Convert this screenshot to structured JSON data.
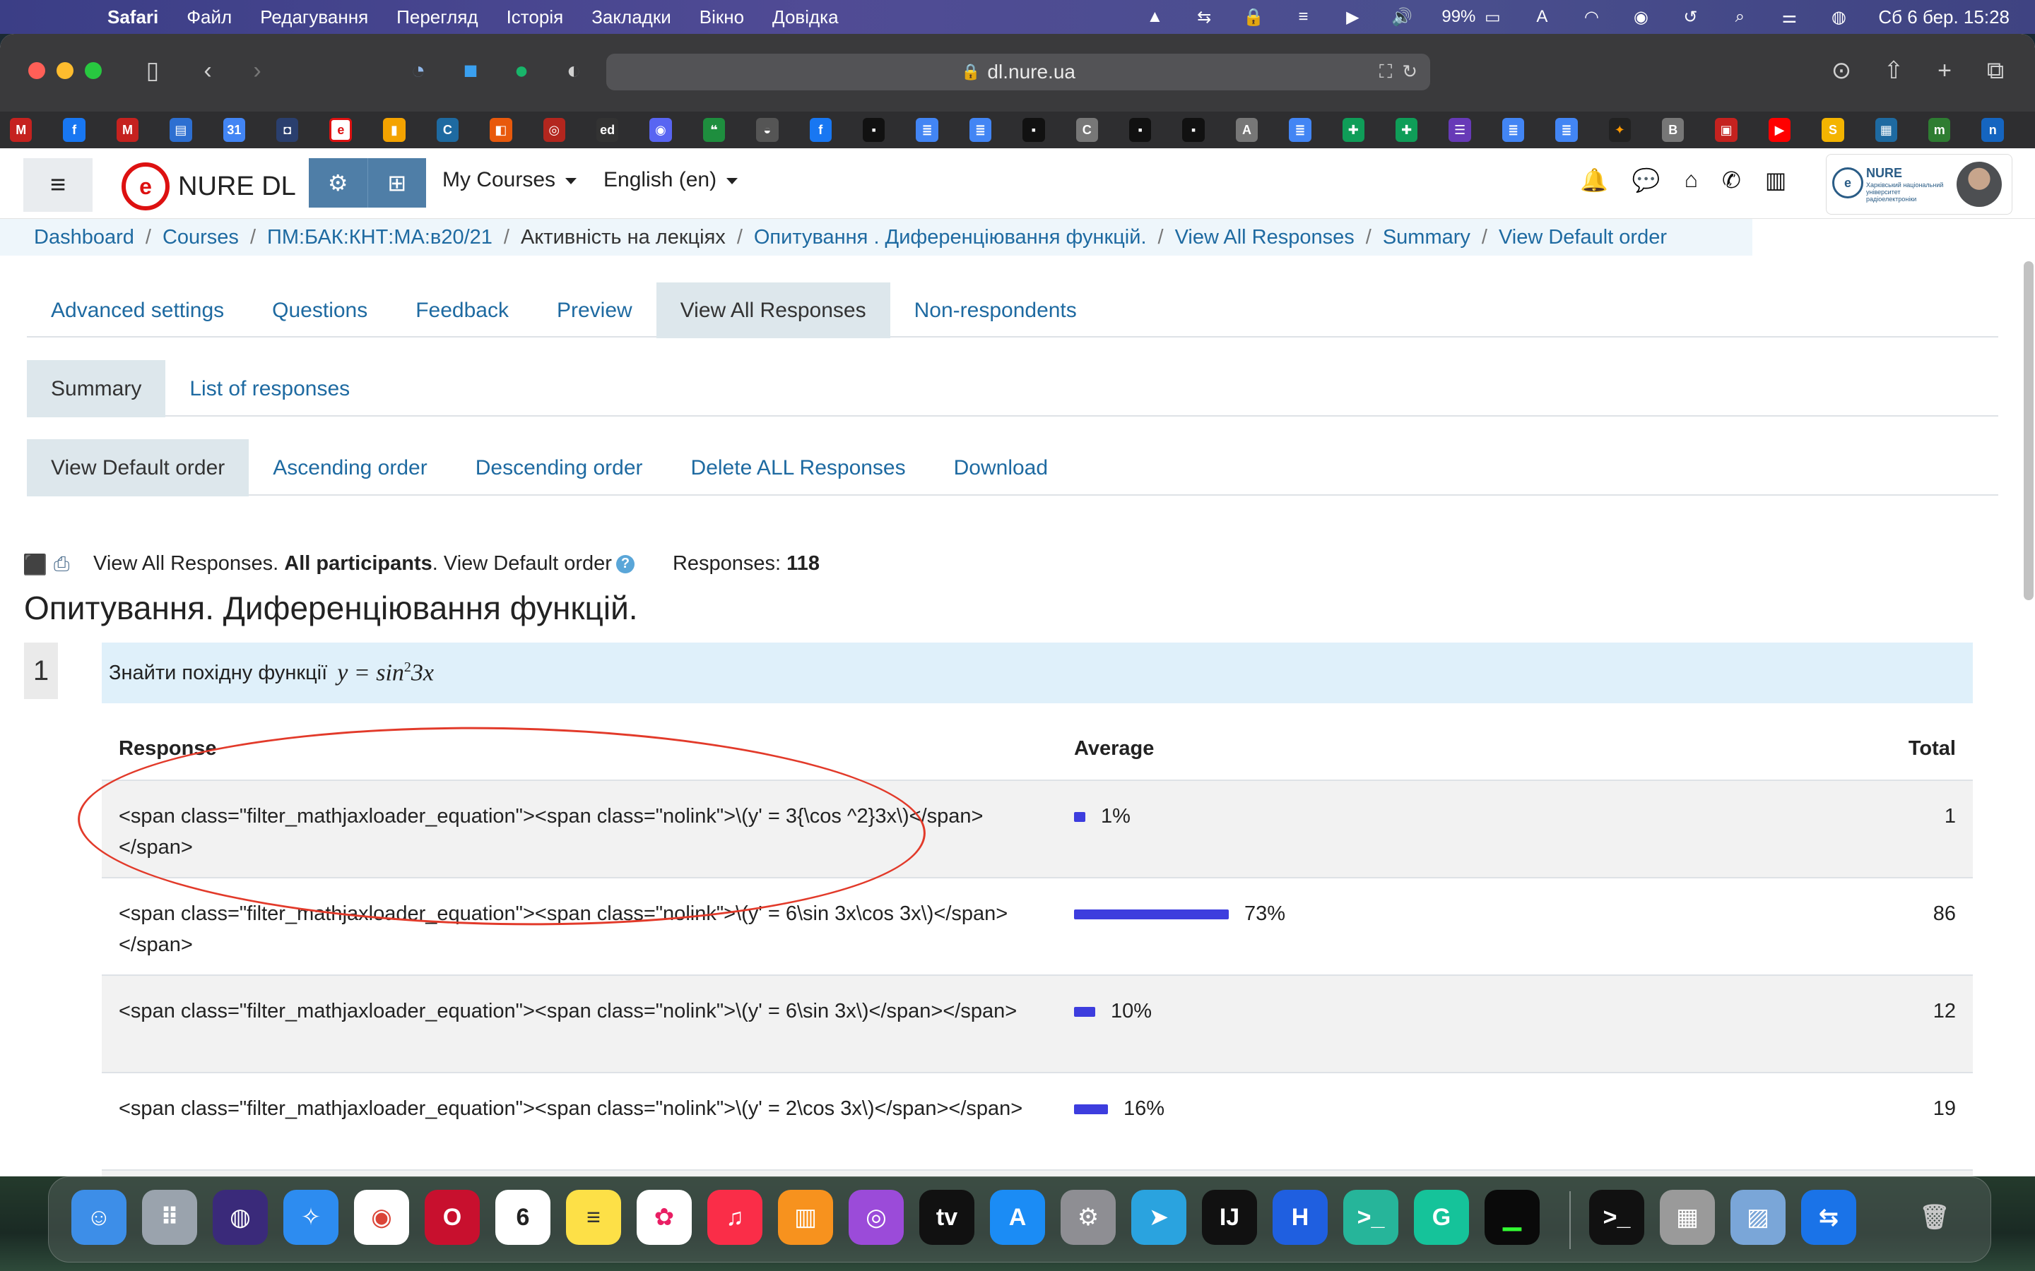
{
  "menubar": {
    "app": "Safari",
    "items": [
      "Файл",
      "Редагування",
      "Перегляд",
      "Історія",
      "Закладки",
      "Вікно",
      "Довідка"
    ],
    "battery": "99%",
    "input_source": "A",
    "clock": "Сб 6 бер.  15:28"
  },
  "browser": {
    "url": "dl.nure.ua"
  },
  "site": {
    "brand": "NURE DL",
    "nav_my_courses": "My Courses",
    "nav_language": "English (en)",
    "user_card_title": "NURE",
    "user_card_subtitle": "Харківський національний університет радіоелектроніки"
  },
  "breadcrumb": {
    "items": [
      "Dashboard",
      "Courses",
      "ПМ:БАК:КНТ:МА:в20/21",
      "Активність на лекціях",
      "Опитування . Диференціювання функцій.",
      "View All Responses",
      "Summary",
      "View Default order"
    ]
  },
  "tabs_main": [
    "Advanced settings",
    "Questions",
    "Feedback",
    "Preview",
    "View All Responses",
    "Non-respondents"
  ],
  "tabs_sub": [
    "Summary",
    "List of responses"
  ],
  "tabs_order": [
    "View Default order",
    "Ascending order",
    "Descending order",
    "Delete ALL Responses",
    "Download"
  ],
  "info": {
    "prefix": "View All Responses.",
    "participants": "All participants",
    "order": ". View Default order",
    "responses_label": "Responses:",
    "responses_count": "118"
  },
  "survey_title": "Опитування. Диференціювання функцій.",
  "question": {
    "number": "1",
    "text": "Знайти похідну функції",
    "math_lhs": "y = sin",
    "math_exp": "2",
    "math_rhs": "3x"
  },
  "table": {
    "headers": {
      "response": "Response",
      "average": "Average",
      "total": "Total"
    },
    "rows": [
      {
        "response": "<span class=\"filter_mathjaxloader_equation\"><span class=\"nolink\">\\(y' = 3{\\cos ^2}3x\\)</span></span>",
        "percent": 1,
        "percent_label": "1%",
        "total": "1"
      },
      {
        "response": "<span class=\"filter_mathjaxloader_equation\"><span class=\"nolink\">\\(y' = 6\\sin 3x\\cos 3x\\)</span></span>",
        "percent": 73,
        "percent_label": "73%",
        "total": "86"
      },
      {
        "response": "<span class=\"filter_mathjaxloader_equation\"><span class=\"nolink\">\\(y' = 6\\sin 3x\\)</span></span>",
        "percent": 10,
        "percent_label": "10%",
        "total": "12"
      },
      {
        "response": "<span class=\"filter_mathjaxloader_equation\"><span class=\"nolink\">\\(y' = 2\\cos 3x\\)</span></span>",
        "percent": 16,
        "percent_label": "16%",
        "total": "19"
      }
    ]
  },
  "colors": {
    "link": "#1e6aa1",
    "bar": "#3d3dde",
    "annotation": "#e23a2a",
    "question_bg": "#dff0fa"
  }
}
